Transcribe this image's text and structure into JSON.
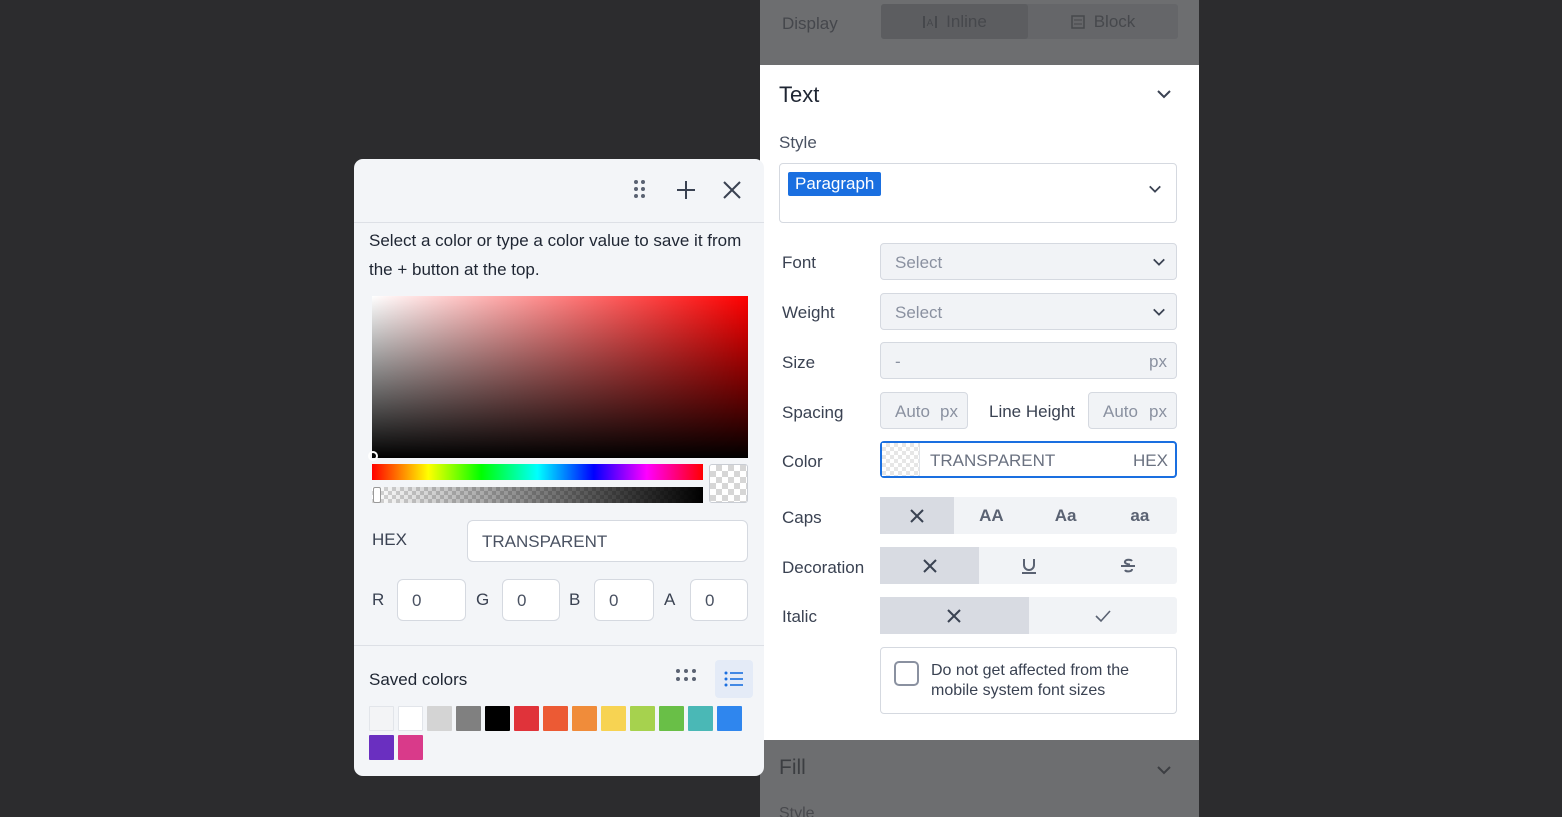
{
  "display": {
    "label": "Display",
    "options": [
      "Inline",
      "Block"
    ]
  },
  "text_section": {
    "title": "Text",
    "style_label": "Style",
    "style_value": "Paragraph",
    "font": {
      "label": "Font",
      "placeholder": "Select"
    },
    "weight": {
      "label": "Weight",
      "placeholder": "Select"
    },
    "size": {
      "label": "Size",
      "placeholder": "-",
      "unit": "px"
    },
    "spacing": {
      "label": "Spacing",
      "placeholder": "Auto",
      "unit": "px"
    },
    "line_height": {
      "label": "Line Height",
      "placeholder": "Auto",
      "unit": "px"
    },
    "color": {
      "label": "Color",
      "value": "TRANSPARENT",
      "mode": "HEX"
    },
    "caps": {
      "label": "Caps",
      "options": [
        "none",
        "AA",
        "Aa",
        "aa"
      ],
      "selected": "none"
    },
    "decoration": {
      "label": "Decoration",
      "options": [
        "none",
        "underline",
        "strikethrough"
      ],
      "selected": "none"
    },
    "italic": {
      "label": "Italic",
      "options": [
        "off",
        "on"
      ],
      "selected": "off"
    },
    "mobile_font_checkbox": {
      "label": "Do not get affected from the mobile system font sizes",
      "checked": false
    }
  },
  "fill_section": {
    "title": "Fill",
    "style_label": "Style"
  },
  "picker": {
    "description": "Select a color or type a color value to save it from the + button at the top.",
    "hex_label": "HEX",
    "hex_value": "TRANSPARENT",
    "r_label": "R",
    "r_value": "0",
    "g_label": "G",
    "g_value": "0",
    "b_label": "B",
    "b_value": "0",
    "a_label": "A",
    "a_value": "0",
    "saved_label": "Saved colors",
    "saved_colors": [
      "#f3f4f6",
      "#ffffff",
      "#d4d4d4",
      "#808080",
      "#000000",
      "#e0333a",
      "#ec5a34",
      "#f08c3a",
      "#f7d352",
      "#a6d24e",
      "#69bf47",
      "#4ab8b6",
      "#2f86ee",
      "#6a2fc0",
      "#d93a8a"
    ]
  },
  "colors": {
    "accent": "#1a6fe0",
    "selected_segment": "#d8dbe2",
    "panel_bg": "#ffffff",
    "page_bg": "#2c2c2e"
  }
}
